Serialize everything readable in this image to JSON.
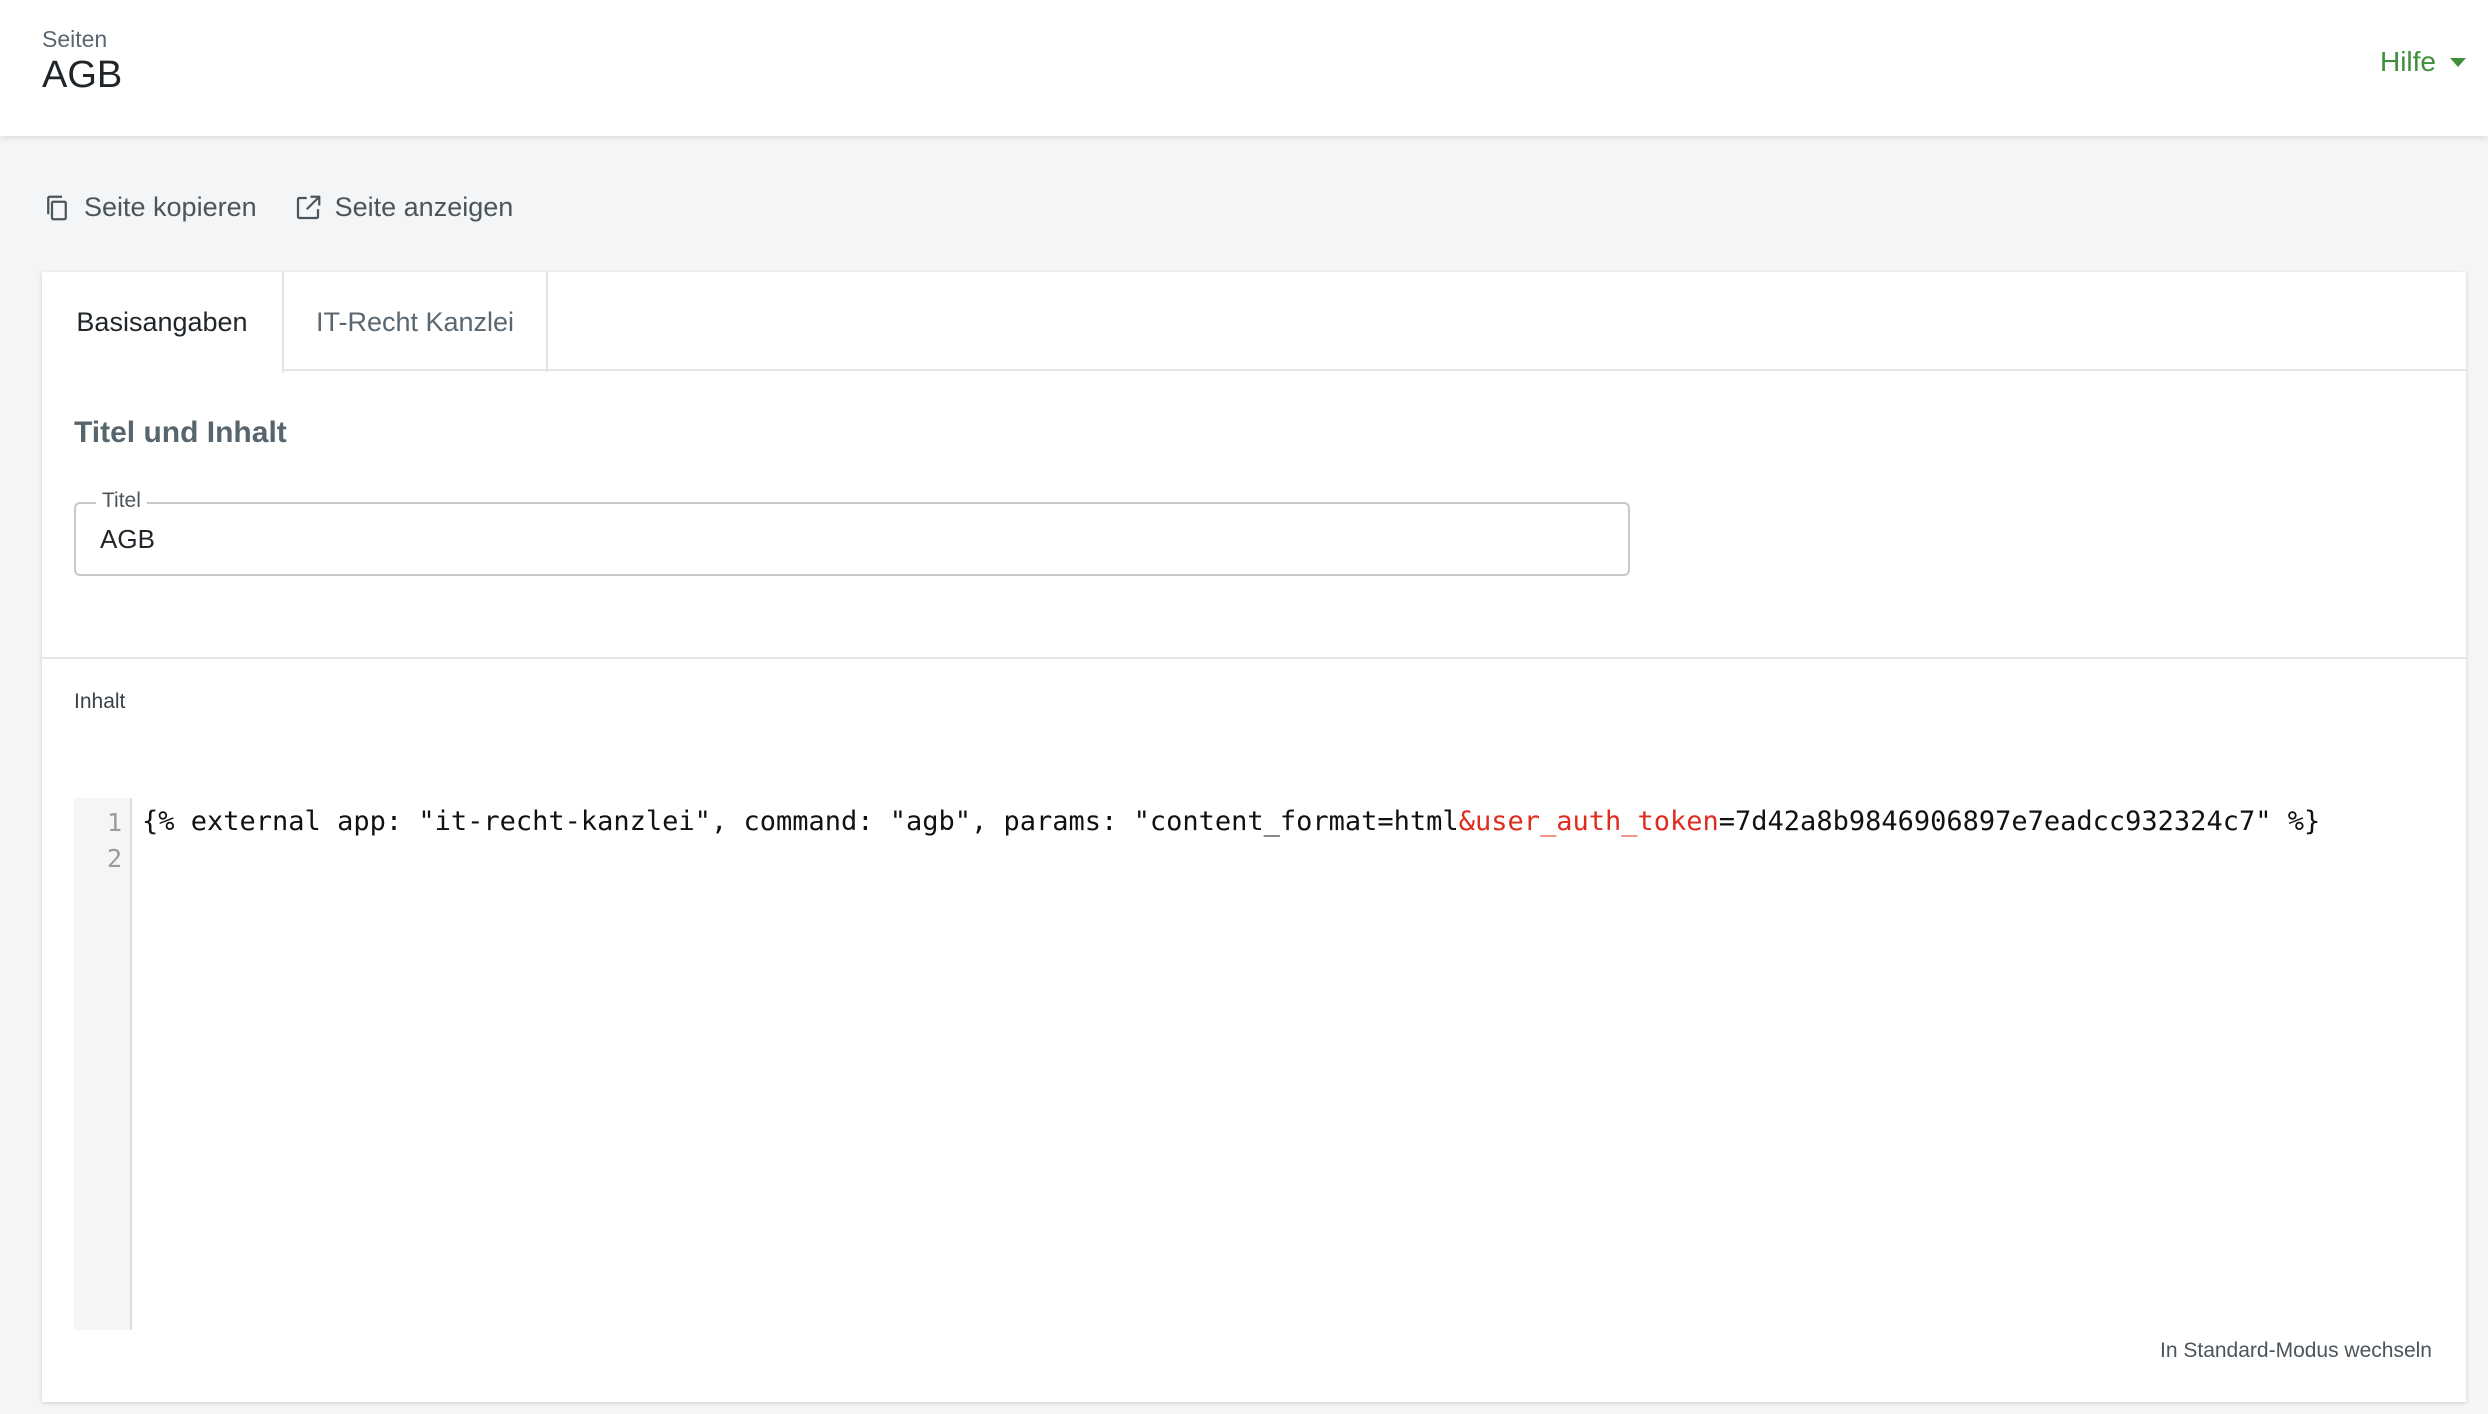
{
  "header": {
    "breadcrumb": "Seiten",
    "title": "AGB",
    "help_label": "Hilfe"
  },
  "actions": {
    "copy_label": "Seite kopieren",
    "view_label": "Seite anzeigen"
  },
  "tabs": [
    {
      "label": "Basisangaben",
      "active": true
    },
    {
      "label": "IT-Recht Kanzlei",
      "active": false
    }
  ],
  "section": {
    "heading": "Titel und Inhalt"
  },
  "title_field": {
    "label": "Titel",
    "value": "AGB"
  },
  "content": {
    "label": "Inhalt",
    "line_numbers": [
      "1",
      "2"
    ],
    "code": {
      "part1": "{% external app: \"it-recht-kanzlei\", command: \"agb\", params: \"content_format=html",
      "part2": "&user_auth_token",
      "part3": "=7d42a8b9846906897e7eadcc932324c7\" %}"
    },
    "mode_switch_label": "In Standard-Modus wechseln"
  },
  "colors": {
    "accent_green": "#3e8e3a",
    "token_red": "#e02c1f"
  },
  "icons": {
    "copy": "copy-icon",
    "view": "external-link-icon",
    "help_caret": "caret-down-icon"
  }
}
